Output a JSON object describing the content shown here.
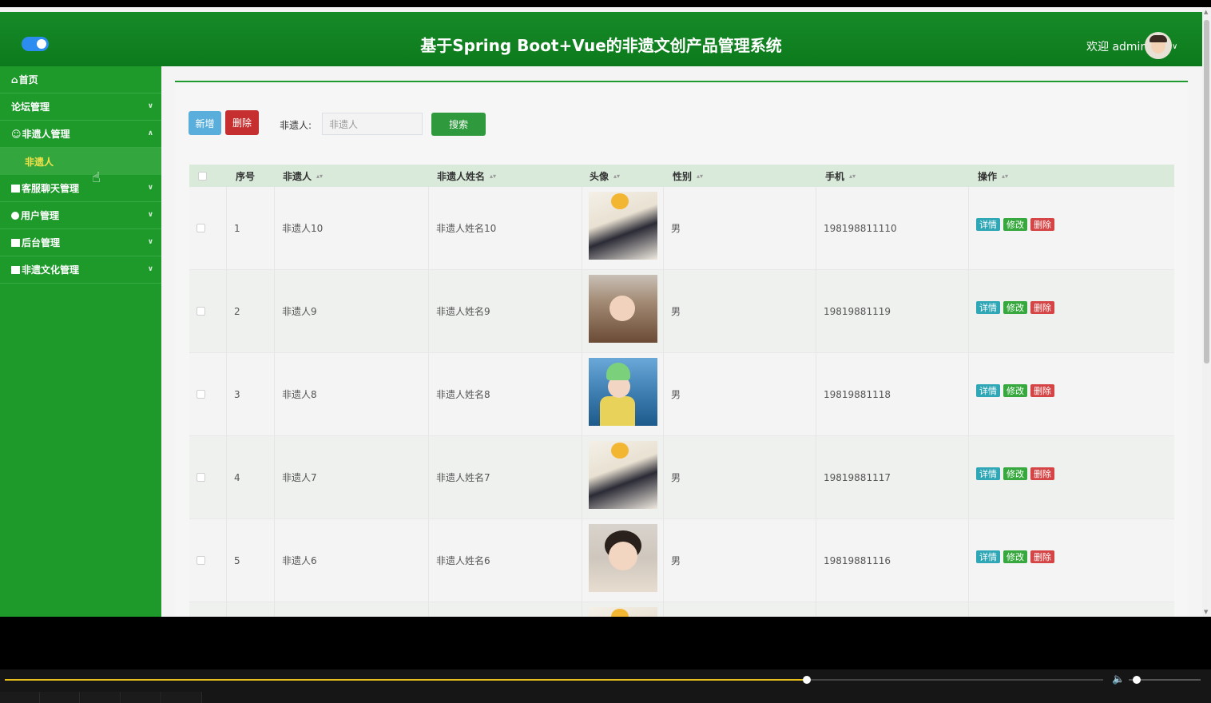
{
  "header": {
    "title": "基于Spring Boot+Vue的非遗文创产品管理系统",
    "welcome": "欢迎 admin"
  },
  "sidebar": {
    "items": [
      {
        "label": "首页",
        "icon": "home-icon"
      },
      {
        "label": "论坛管理",
        "icon": "none"
      },
      {
        "label": "非遗人管理",
        "icon": "user-icon"
      },
      {
        "label": "客服聊天管理",
        "icon": "block-icon"
      },
      {
        "label": "用户管理",
        "icon": "user-round-icon"
      },
      {
        "label": "后台管理",
        "icon": "block-icon"
      },
      {
        "label": "非遗文化管理",
        "icon": "block-icon"
      }
    ],
    "subitem": "非遗人"
  },
  "toolbar": {
    "add_label": "新增",
    "delete_label": "删除",
    "search_label": "非遗人:",
    "search_placeholder": "非遗人",
    "search_button": "搜索"
  },
  "table": {
    "headers": [
      "序号",
      "非遗人",
      "非遗人姓名",
      "头像",
      "性别",
      "手机",
      "操作"
    ],
    "rows": [
      {
        "no": "1",
        "name": "非遗人10",
        "fullname": "非遗人姓名10",
        "gender": "男",
        "phone": "198198811110"
      },
      {
        "no": "2",
        "name": "非遗人9",
        "fullname": "非遗人姓名9",
        "gender": "男",
        "phone": "19819881119"
      },
      {
        "no": "3",
        "name": "非遗人8",
        "fullname": "非遗人姓名8",
        "gender": "男",
        "phone": "19819881118"
      },
      {
        "no": "4",
        "name": "非遗人7",
        "fullname": "非遗人姓名7",
        "gender": "男",
        "phone": "19819881117"
      },
      {
        "no": "5",
        "name": "非遗人6",
        "fullname": "非遗人姓名6",
        "gender": "男",
        "phone": "19819881116"
      }
    ],
    "actions": {
      "detail": "详情",
      "edit": "修改",
      "delete": "删除"
    }
  },
  "player": {
    "progress": 0.73
  },
  "colors": {
    "brand": "#1d9a2a",
    "accent": "#2d8cf0"
  }
}
